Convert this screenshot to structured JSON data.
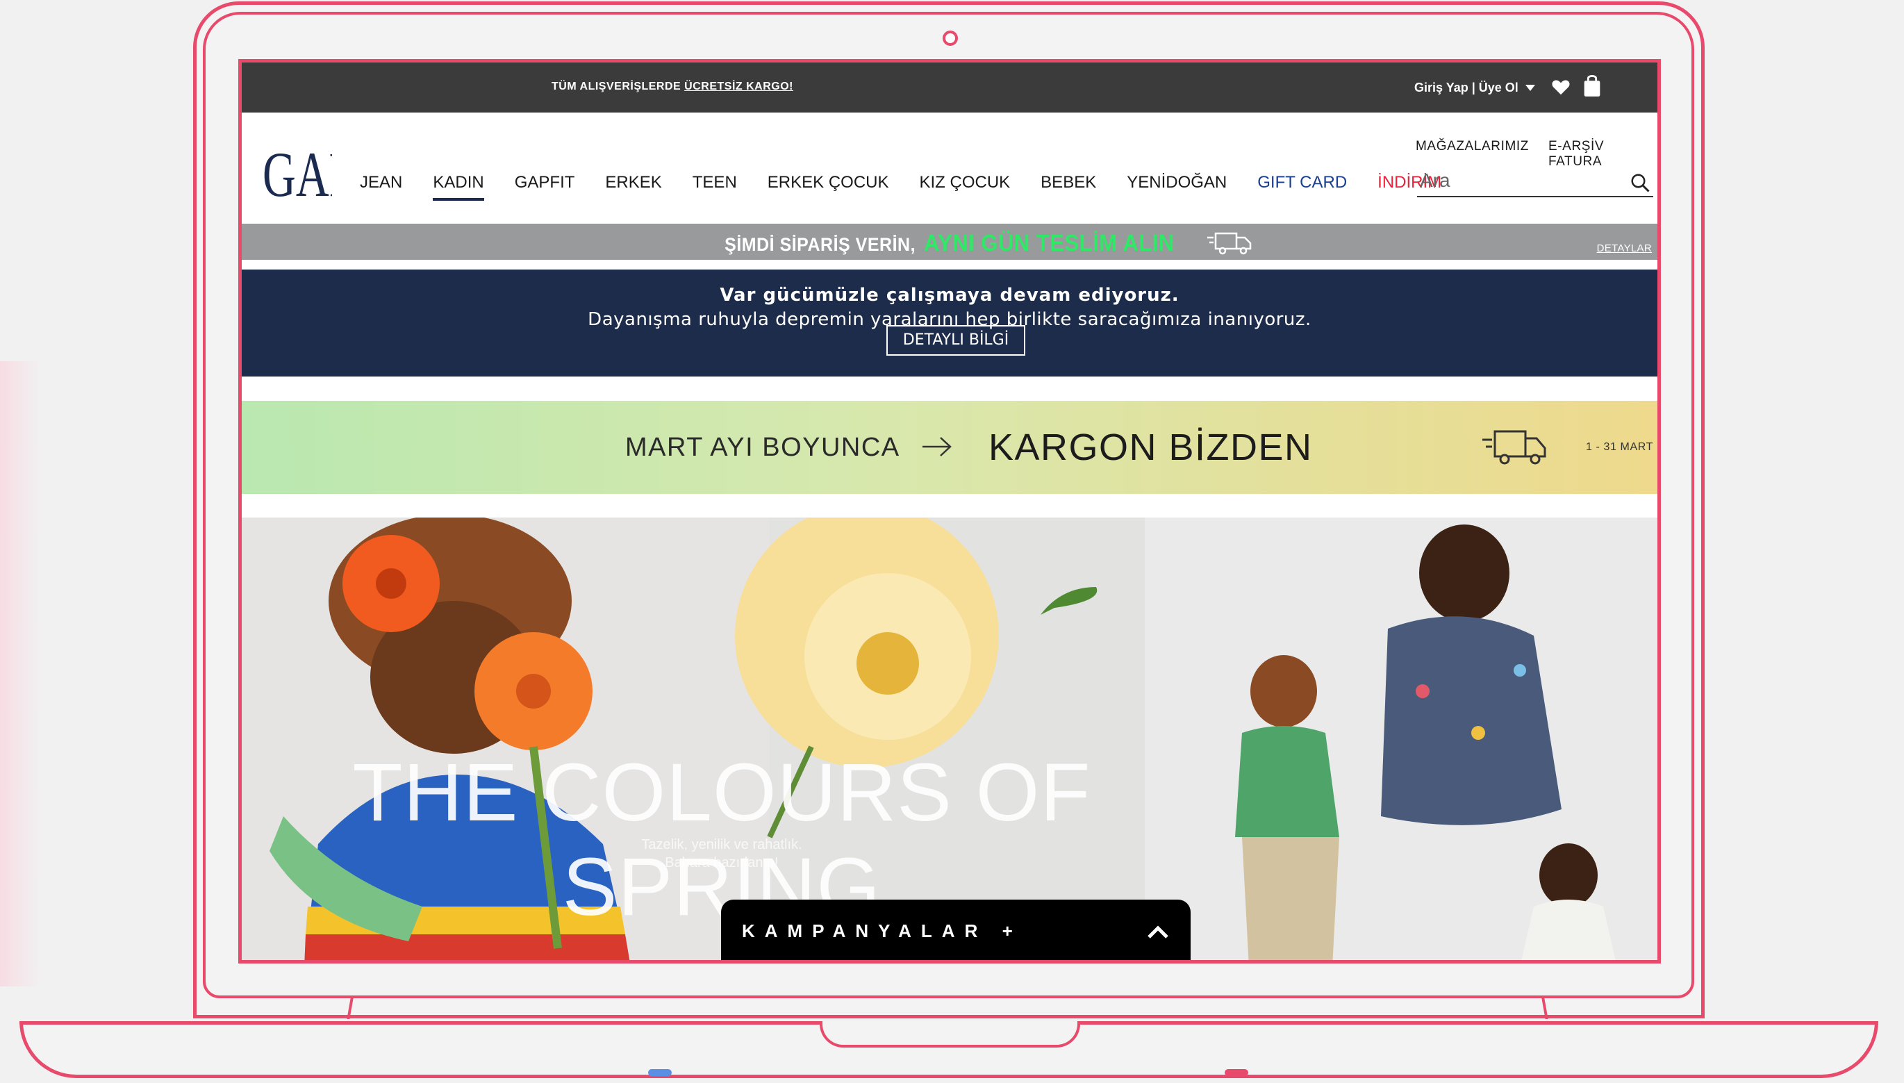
{
  "topbar": {
    "promo_prefix": "TÜM ALIŞVERİŞLERDE ",
    "promo_link": "ÜCRETSİZ KARGO!",
    "account_label": "Giriş Yap | Üye Ol"
  },
  "header": {
    "logo_text": "GAP",
    "nav": [
      {
        "label": "JEAN"
      },
      {
        "label": "KADIN"
      },
      {
        "label": "GAPFIT"
      },
      {
        "label": "ERKEK"
      },
      {
        "label": "TEEN"
      },
      {
        "label": "ERKEK ÇOCUK"
      },
      {
        "label": "KIZ ÇOCUK"
      },
      {
        "label": "BEBEK"
      },
      {
        "label": "YENİDOĞAN"
      },
      {
        "label": "GIFT CARD"
      },
      {
        "label": "İNDİRİM"
      }
    ],
    "stores_link": "MAĞAZALARIMIZ",
    "invoice_link": "E-ARŞİV FATURA",
    "search_placeholder": "Ara"
  },
  "delivery_banner": {
    "text_white": "ŞİMDİ SİPARİŞ VERİN,",
    "text_green": "AYNI GÜN TESLİM ALIN",
    "details_link": "DETAYLAR"
  },
  "notice": {
    "headline": "Var gücümüzle çalışmaya devam ediyoruz.",
    "body": "Dayanışma ruhuyla depremin yaralarını hep birlikte saracağımıza inanıyoruz.",
    "button": "DETAYLI BİLGİ"
  },
  "cargo_banner": {
    "left_text": "MART AYI BOYUNCA",
    "main_text": "KARGON BİZDEN",
    "dates": "1 - 31 MART"
  },
  "hero": {
    "headline": "THE COLOURS OF SPRING",
    "sub_line_1": "Tazelik, yenilik ve rahatlık.",
    "sub_line_2": "Bahara hazırlanın!",
    "campaign_label": "KAMPANYALAR +"
  },
  "colors": {
    "frame": "#e84a6b",
    "topbar": "#3b3b3b",
    "notice_bg": "#1c2c4a",
    "delivery_green": "#2ee866",
    "sale_red": "#e8233a",
    "gift_blue": "#1a3f8f"
  }
}
